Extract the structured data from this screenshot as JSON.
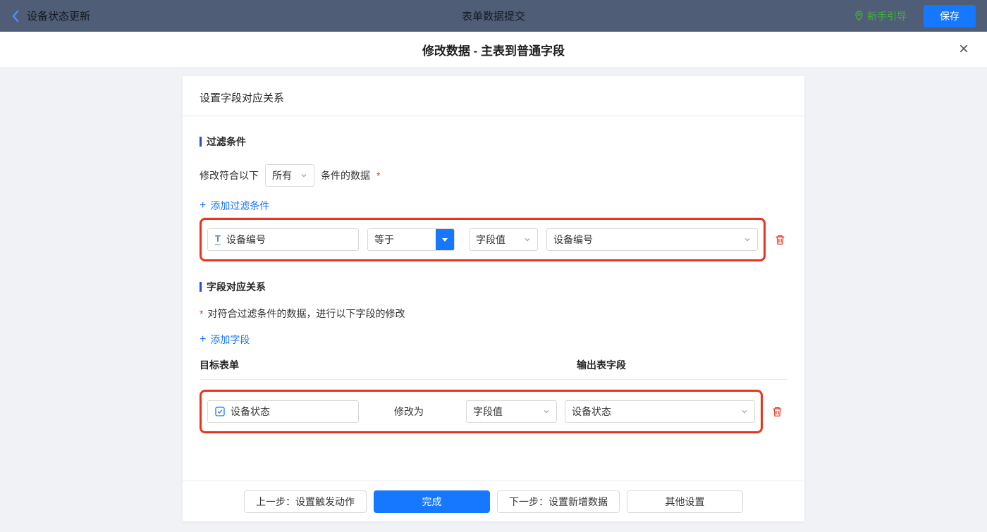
{
  "colors": {
    "primary": "#1677ff",
    "danger": "#e8341c",
    "green": "#3eb13c",
    "topbar": "#505d76"
  },
  "icons": {
    "plus": "+",
    "close": "×",
    "text_field": "T"
  },
  "topbar": {
    "back_label": "设备状态更新",
    "center_title": "表单数据提交",
    "guide_label": "新手引导",
    "save_label": "保存"
  },
  "modal": {
    "title": "修改数据 - 主表到普通字段"
  },
  "card": {
    "header": "设置字段对应关系",
    "filter": {
      "title": "过滤条件",
      "prefix": "修改符合以下",
      "mode": "所有",
      "suffix": "条件的数据",
      "required": "*",
      "add_label": "添加过滤条件",
      "row": {
        "field": "设备编号",
        "operator": "等于",
        "value_type": "字段值",
        "value_field": "设备编号"
      }
    },
    "mapping": {
      "title": "字段对应关系",
      "required": "*",
      "description": "对符合过滤条件的数据，进行以下字段的修改",
      "add_label": "添加字段",
      "col_target": "目标表单",
      "col_output": "输出表字段",
      "row": {
        "field": "设备状态",
        "action": "修改为",
        "value_type": "字段值",
        "value_field": "设备状态"
      }
    },
    "footer": {
      "prev": "上一步：设置触发动作",
      "done": "完成",
      "next": "下一步：设置新增数据",
      "other": "其他设置"
    }
  }
}
